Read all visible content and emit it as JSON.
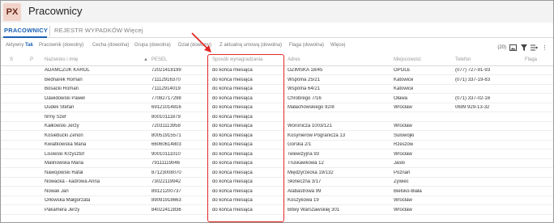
{
  "app": {
    "logo": "PX",
    "title": "Pracownicy"
  },
  "tabs": [
    {
      "label": "PRACOWNICY",
      "active": true
    },
    {
      "label": "REJESTR WYPADKÓW",
      "active": false
    },
    {
      "label": "Więcej",
      "active": false
    }
  ],
  "filters": {
    "aktywny_label": "Aktywny",
    "aktywny_value": "Tak",
    "items": [
      "Pracownik (dowolny)",
      "Cecha (dowolna)",
      "Grupa (dowolna)",
      "Dział (dowolny)",
      "Z aktualną umową (dowolna)",
      "Flaga (dowolna)",
      "Więcej"
    ]
  },
  "toolbar": {
    "count": "(20)"
  },
  "columns": [
    "S",
    "P",
    "Nazwisko i imię",
    "PESEL",
    "Sposób wynagradzania",
    "Adres",
    "Miejscowość",
    "Telefon",
    "Flaga"
  ],
  "rows": [
    {
      "name": "ADAMCZUK KAROL",
      "pesel": "72021418199",
      "pay": "do końca miesiąca",
      "addr": "OZIMSKA 18/45",
      "city": "OPOLE",
      "phone": "(077) 727-91-93"
    },
    {
      "name": "Bednarek Roman",
      "pesel": "71112916370",
      "pay": "do końca miesiąca",
      "addr": "Wspólna 25/21",
      "city": "Katowice",
      "phone": "(071) 337-19-83"
    },
    {
      "name": "Bosacki Roman",
      "pesel": "71112914019",
      "pay": "do końca miesiąca",
      "addr": "Wspólna 64/21",
      "city": "Katowice",
      "phone": ""
    },
    {
      "name": "Dawidowski Paweł",
      "pesel": "77082717298",
      "pay": "do końca miesiąca",
      "addr": "Chrobrego 7/16",
      "city": "Oława",
      "phone": "(071) 337-02-16"
    },
    {
      "name": "Dudek Stefan",
      "pesel": "69121014816",
      "pay": "do końca miesiąca",
      "addr": "Małachowskiego 92/8",
      "city": "Wrocław",
      "phone": "0699 929-13-32"
    },
    {
      "name": "firmy Szef",
      "pesel": "80010111879",
      "pay": "do końca miesiąca",
      "addr": "",
      "city": "",
      "phone": ""
    },
    {
      "name": "Kałkowski Jerzy",
      "pesel": "72031113958",
      "pay": "do końca miesiąca",
      "addr": "Woroniczа 1003/121",
      "city": "Wrocław",
      "phone": ""
    },
    {
      "name": "Kosiebucki Zenon",
      "pesel": "80051915571",
      "pay": "do końca miesiąca",
      "addr": "Kosynierów Pogranicza 13",
      "city": "Sulowójki",
      "phone": ""
    },
    {
      "name": "Kwiatkowska Maria",
      "pesel": "66060614803",
      "pay": "do końca miesiąca",
      "addr": "Górska 2/1",
      "city": "Rzeszów",
      "phone": ""
    },
    {
      "name": "Lisowski Krzysztof",
      "pesel": "90010111010",
      "pay": "do końca miesiąca",
      "addr": "Telewizyjna 93",
      "city": "Wrocław",
      "phone": ""
    },
    {
      "name": "Malinowska Maria",
      "pesel": "79111119046",
      "pay": "do końca miesiąca",
      "addr": "Truskawkowa 12",
      "city": "Jasło",
      "phone": ""
    },
    {
      "name": "Nawojowski Rafał",
      "pesel": "87123008070",
      "pay": "do końca miesiąca",
      "addr": "Międzyrzecka 19/132",
      "city": "Poznań",
      "phone": ""
    },
    {
      "name": "Nowacka - kadrowa Anna",
      "pesel": "73022119942",
      "pay": "do końca miesiąca",
      "addr": "Słoneczna 3/17",
      "city": "Żywiec",
      "phone": ""
    },
    {
      "name": "Nowak Jan",
      "pesel": "89121200737",
      "pay": "do końca miesiąca",
      "addr": "Alabastrowa 99",
      "city": "Bielsko-Biała",
      "phone": ""
    },
    {
      "name": "Orłowska Małgorzata",
      "pesel": "89091918663",
      "pay": "do końca miesiąca",
      "addr": "Koszykowa 19",
      "city": "Wrocław",
      "phone": ""
    },
    {
      "name": "Pakamera Jerzy",
      "pesel": "84022412836",
      "pay": "do końca miesiąca",
      "addr": "Bitwy Warszawskiej 301",
      "city": "Wrocław",
      "phone": ""
    }
  ],
  "colors": {
    "accent": "#1a5fb4",
    "highlight": "#e32626",
    "logo_bg": "#f2d3c9"
  }
}
